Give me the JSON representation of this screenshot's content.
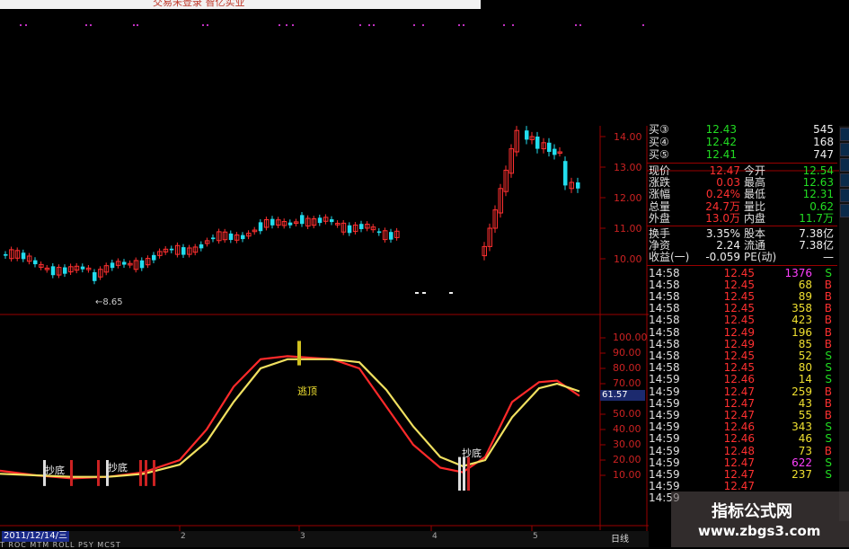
{
  "app": {
    "top_title": "交易未登录 智亿实业"
  },
  "price_chart": {
    "y_ticks": [
      "14.00",
      "13.00",
      "12.00",
      "11.00",
      "10.00"
    ],
    "low_marker": "←8.65"
  },
  "indicator": {
    "y_ticks": [
      "100.00",
      "90.00",
      "80.00",
      "70.00",
      "60.00",
      "50.00",
      "40.00",
      "30.00",
      "20.00",
      "10.00"
    ],
    "current_value": "61.57",
    "annotations": {
      "top": "逃顶",
      "bottom1": "抄底",
      "bottom2": "抄底",
      "bottom3": "抄底"
    }
  },
  "bottom": {
    "date": "2011/12/14/三",
    "tabs": "T  ROC  MTM  ROLL  PSY  MCST",
    "period": "日线",
    "x_ticks": [
      "2",
      "3",
      "4",
      "5"
    ]
  },
  "quote_panel": {
    "bids": [
      {
        "label": "买③",
        "price": "12.43",
        "vol": "545"
      },
      {
        "label": "买④",
        "price": "12.42",
        "vol": "168"
      },
      {
        "label": "买⑤",
        "price": "12.41",
        "vol": "747"
      }
    ],
    "stats": [
      {
        "l1": "现价",
        "v1": "12.47",
        "l2": "今开",
        "v2": "12.54"
      },
      {
        "l1": "涨跌",
        "v1": "0.03",
        "l2": "最高",
        "v2": "12.63"
      },
      {
        "l1": "涨幅",
        "v1": "0.24%",
        "l2": "最低",
        "v2": "12.31"
      },
      {
        "l1": "总量",
        "v1": "24.7万",
        "l2": "量比",
        "v2": "0.62"
      },
      {
        "l1": "外盘",
        "v1": "13.0万",
        "l2": "内盘",
        "v2": "11.7万"
      }
    ],
    "fund": [
      {
        "l1": "换手",
        "v1": "3.35%",
        "l2": "股本",
        "v2": "7.38亿"
      },
      {
        "l1": "净资",
        "v1": "2.24",
        "l2": "流通",
        "v2": "7.38亿"
      },
      {
        "l1": "收益(一)",
        "v1": "-0.059",
        "l2": "PE(动)",
        "v2": "—"
      }
    ],
    "ticks": [
      [
        "14:58",
        "12.45",
        "1376",
        "S"
      ],
      [
        "14:58",
        "12.45",
        "68",
        "B"
      ],
      [
        "14:58",
        "12.45",
        "89",
        "B"
      ],
      [
        "14:58",
        "12.45",
        "358",
        "B"
      ],
      [
        "14:58",
        "12.45",
        "423",
        "B"
      ],
      [
        "14:58",
        "12.49",
        "196",
        "B"
      ],
      [
        "14:58",
        "12.49",
        "85",
        "B"
      ],
      [
        "14:58",
        "12.45",
        "52",
        "S"
      ],
      [
        "14:58",
        "12.45",
        "80",
        "S"
      ],
      [
        "14:59",
        "12.46",
        "14",
        "S"
      ],
      [
        "14:59",
        "12.47",
        "259",
        "B"
      ],
      [
        "14:59",
        "12.47",
        "43",
        "B"
      ],
      [
        "14:59",
        "12.47",
        "55",
        "B"
      ],
      [
        "14:59",
        "12.46",
        "343",
        "S"
      ],
      [
        "14:59",
        "12.46",
        "46",
        "S"
      ],
      [
        "14:59",
        "12.48",
        "73",
        "B"
      ],
      [
        "14:59",
        "12.47",
        "622",
        "S"
      ],
      [
        "14:59",
        "12.47",
        "237",
        "S"
      ],
      [
        "14:59",
        "12.47",
        "",
        ""
      ],
      [
        "14:59",
        "",
        "",
        ""
      ]
    ]
  },
  "watermark": {
    "line1": "指标公式网",
    "line2": "www.zbgs3.com"
  },
  "colors": {
    "up": "#ff3030",
    "down": "#22ddee",
    "grid": "#9a0000",
    "k_line": "#ff2a2a",
    "d_line": "#f0e060"
  }
}
